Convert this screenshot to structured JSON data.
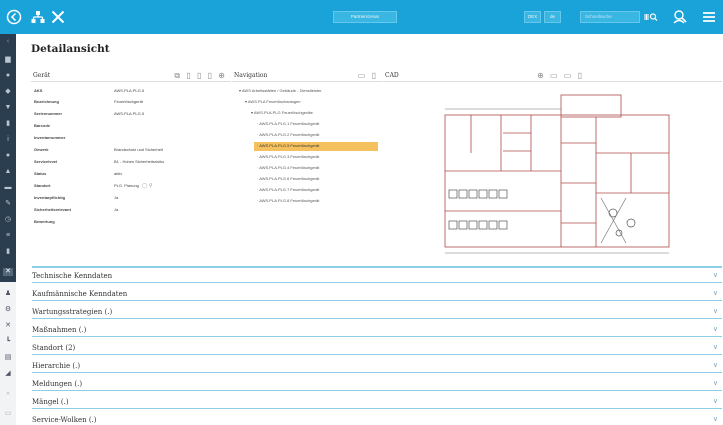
{
  "topbar": {
    "icons": [
      "back-icon",
      "hierarchy-icon",
      "tools-icon"
    ],
    "center_button": "Partnerszenar",
    "btn_a": "DEX",
    "btn_b": "de",
    "search_placeholder": "Schnellsuche",
    "right_icons": [
      "barcode-search-icon",
      "user-search-icon",
      "menu-icon"
    ]
  },
  "page": {
    "title": "Detailansicht"
  },
  "panels": {
    "geraet": "Gerät",
    "navigation": "Navigation",
    "cad": "CAD"
  },
  "details": [
    {
      "label": "AKS",
      "value": "AWS.PLA.PLG.5"
    },
    {
      "label": "Bezeichnung",
      "value": "Feuerlöschgerät"
    },
    {
      "label": "Seriennummer",
      "value": "AWS.PLA.PLG.5"
    },
    {
      "label": "Barcode",
      "value": ""
    },
    {
      "label": "Inventarnummer",
      "value": ""
    },
    {
      "label": "Gewerk",
      "value": "Brandschutz und Sicherheit"
    },
    {
      "label": "Servicelevel",
      "value": "B1 - Hohes Sicherheitsrisiko"
    },
    {
      "label": "Status",
      "value": "aktiv"
    },
    {
      "label": "Standort",
      "value": "PLG. Planung"
    },
    {
      "label": "Inventarpflichtig",
      "value": "Ja"
    },
    {
      "label": "Sicherheitsrelevant",
      "value": "Ja"
    },
    {
      "label": "Bewertung",
      "value": ""
    }
  ],
  "tree": [
    {
      "label": "AWS Arbeitsstätten / Gebäude - Dienstleister",
      "level": 0,
      "selected": false
    },
    {
      "label": "AWS.PLA Feuerlöschanlagen",
      "level": 1,
      "selected": false
    },
    {
      "label": "AWS.PLA.PLG Feuerlöschgeräte",
      "level": 2,
      "selected": false
    },
    {
      "label": "AWS.PLA.PLG.1 Feuerlöschgerät",
      "level": 3,
      "selected": false
    },
    {
      "label": "AWS.PLA.PLG.2 Feuerlöschgerät",
      "level": 3,
      "selected": false
    },
    {
      "label": "AWS.PLA.PLG.5 Feuerlöschgerät",
      "level": 3,
      "selected": true
    },
    {
      "label": "AWS.PLA.PLG.3 Feuerlöschgerät",
      "level": 3,
      "selected": false
    },
    {
      "label": "AWS.PLA.PLG.4 Feuerlöschgerät",
      "level": 3,
      "selected": false
    },
    {
      "label": "AWS.PLA.PLG.6 Feuerlöschgerät",
      "level": 3,
      "selected": false
    },
    {
      "label": "AWS.PLA.PLG.7 Feuerlöschgerät",
      "level": 3,
      "selected": false
    },
    {
      "label": "AWS.PLA.PLG.8 Feuerlöschgerät",
      "level": 3,
      "selected": false
    }
  ],
  "accordion": [
    "Technische Kenndaten",
    "Kaufmännische Kenndaten",
    "Wartungsstrategien (.)",
    "Maßnahmen (.)",
    "Standort (2)",
    "Hierarchie (.)",
    "Meldungen (.)",
    "Mängel (.)",
    "Service-Wolken (.)"
  ],
  "colors": {
    "topbar": "#1aa3d8",
    "sidebar": "#2b3e4f",
    "selection": "#f5c15e",
    "accordion_line": "#8ecfe8",
    "plan_line": "#b04a4a"
  }
}
